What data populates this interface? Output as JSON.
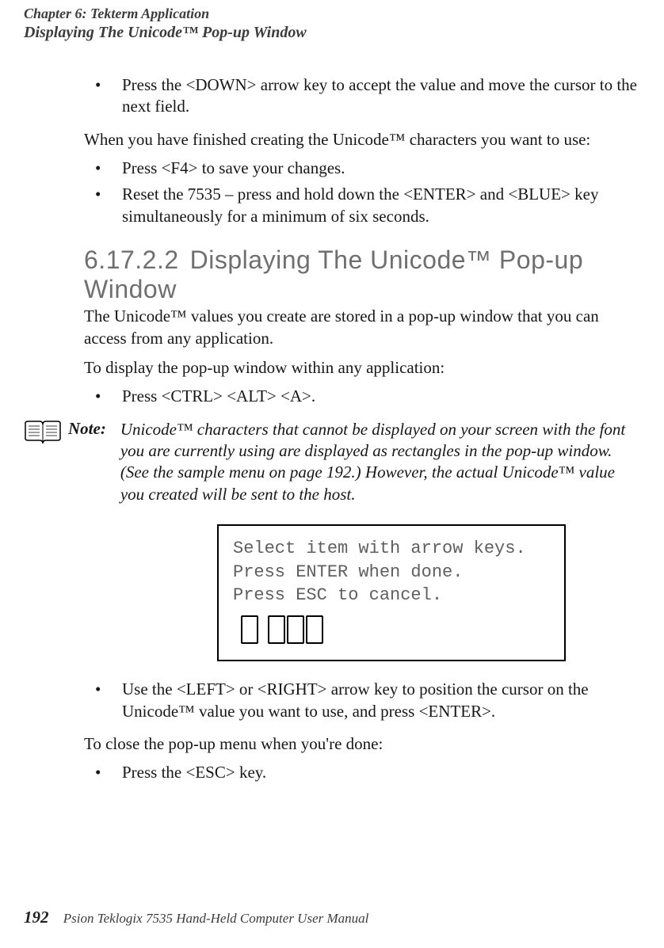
{
  "header": {
    "chapter": "Chapter 6: Tekterm Application",
    "section": "Displaying The Unicode™ Pop-up Window"
  },
  "body": {
    "bullet1": "Press the <DOWN> arrow key to accept the value and move the cursor to the next field.",
    "para1": "When you have finished creating the Unicode™ characters you want to use:",
    "bullet2a": "Press <F4> to save your changes.",
    "bullet2b": "Reset the 7535 – press and hold down the <ENTER> and <BLUE> key simultaneously for a minimum of six seconds.",
    "heading_num": "6.17.2.2",
    "heading_title": "Displaying The Unicode™  Pop-up Window",
    "para2": "The Unicode™ values you create are stored in a pop-up window that you can access from any application.",
    "para3": "To display the pop-up window within any application:",
    "bullet3": "Press <CTRL> <ALT> <A>.",
    "note_label": "Note:",
    "note_text": "Unicode™ characters that cannot be displayed on your screen with the font you are currently using are displayed as rectangles in the pop-up window. (See the sample menu on page 192.) However, the actual Unicode™ value you created will be sent to the host.",
    "sample_line1": "Select item with arrow keys.",
    "sample_line2": "Press ENTER when done.",
    "sample_line3": "Press ESC to cancel.",
    "bullet4": "Use the <LEFT> or <RIGHT> arrow key to position the cursor on the Unicode™ value you want to use, and press <ENTER>.",
    "para4": "To close the pop-up menu when you're done:",
    "bullet5": "Press the <ESC> key."
  },
  "footer": {
    "page": "192",
    "title": "Psion Teklogix 7535 Hand-Held Computer User Manual"
  }
}
